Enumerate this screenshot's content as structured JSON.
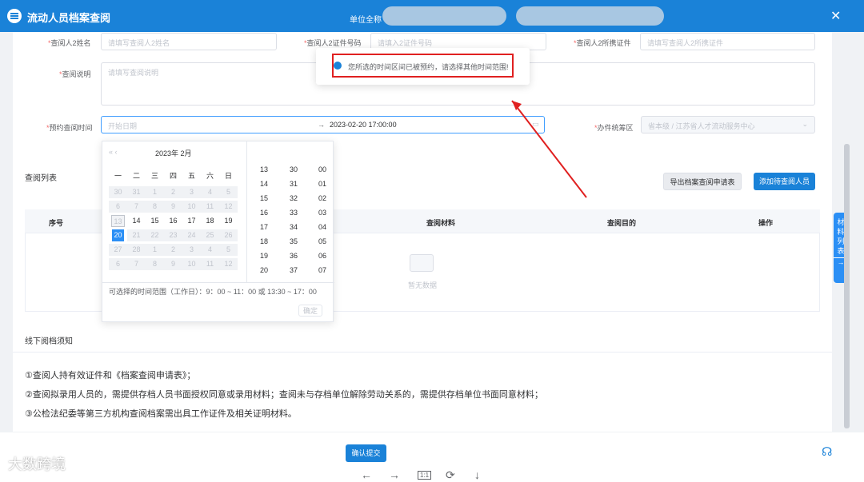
{
  "header": {
    "title": "流动人员档案查阅",
    "unit_label": "单位全称",
    "close_icon": "close-icon"
  },
  "form": {
    "name2": {
      "label": "查阅人2姓名",
      "placeholder": "请填写查阅人2姓名"
    },
    "idno2": {
      "label": "查阅人2证件号码",
      "placeholder": "请填入2证件号码"
    },
    "cert2": {
      "label": "查阅人2所携证件",
      "placeholder": "请填写查阅人2所携证件"
    },
    "desc": {
      "label": "查阅说明",
      "placeholder": "请填写查阅说明"
    },
    "date": {
      "label": "预约查阅时间",
      "start_placeholder": "开始日期",
      "separator": "→",
      "end_value": "2023-02-20 17:00:00"
    },
    "office": {
      "label": "办件统筹区",
      "value": "省本级 / 江苏省人才流动服务中心"
    }
  },
  "toast": {
    "message": "您所选的时间区间已被预约，请选择其他时间范围!"
  },
  "picker": {
    "nav_prev": "« ‹",
    "nav_next": "› »",
    "month_title": "2023年  2月",
    "weekdays": [
      "一",
      "二",
      "三",
      "四",
      "五",
      "六",
      "日"
    ],
    "weeks": [
      [
        "30",
        "31",
        "1",
        "2",
        "3",
        "4",
        "5"
      ],
      [
        "6",
        "7",
        "8",
        "9",
        "10",
        "11",
        "12"
      ],
      [
        "13",
        "14",
        "15",
        "16",
        "17",
        "18",
        "19"
      ],
      [
        "20",
        "21",
        "22",
        "23",
        "24",
        "25",
        "26"
      ],
      [
        "27",
        "28",
        "1",
        "2",
        "3",
        "4",
        "5"
      ],
      [
        "6",
        "7",
        "8",
        "9",
        "10",
        "11",
        "12"
      ]
    ],
    "hours": [
      "13",
      "14",
      "15",
      "16",
      "17",
      "18",
      "19",
      "20"
    ],
    "minutes": [
      "30",
      "31",
      "32",
      "33",
      "34",
      "35",
      "36",
      "37"
    ],
    "seconds": [
      "00",
      "01",
      "02",
      "03",
      "04",
      "05",
      "06",
      "07"
    ],
    "hint": "可选择的时间范围（工作日）：9：00 ~ 11：00 或 13:30 ~ 17：00",
    "confirm": "确定"
  },
  "list": {
    "title": "查阅列表",
    "export_btn": "导出档案查阅申请表",
    "add_btn": "添加待查阅人员",
    "columns": [
      "序号",
      "查阅材料",
      "查阅目的",
      "操作"
    ],
    "empty": "暂无数据"
  },
  "notes": {
    "title": "线下阅档须知",
    "items": [
      "①查阅人持有效证件和《档案查阅申请表》；",
      "②查阅拟录用人员的，需提供存档人员书面授权同意或录用材料；查阅未与存档单位解除劳动关系的，需提供存档单位书面同意材料；",
      "③公检法纪委等第三方机构查阅档案需出具工作证件及相关证明材料。"
    ]
  },
  "side_tab": {
    "label": "材料列表",
    "arrow": "→"
  },
  "footer": {
    "submit": "确认提交",
    "watermark": "大数跨境",
    "tools": [
      "←",
      "→",
      "1:1",
      "⟳",
      "↓"
    ]
  },
  "colors": {
    "brand": "#1a82d8",
    "alert": "#e02020",
    "today": "#2b8ff5"
  }
}
